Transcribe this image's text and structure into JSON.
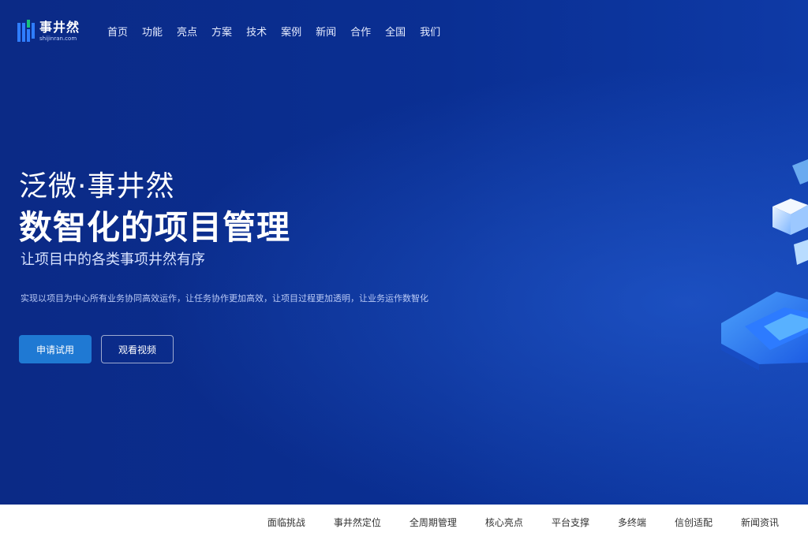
{
  "brand": {
    "name": "事井然",
    "domain": "shijinran.com",
    "colors": {
      "primary": "#1f79d3",
      "hero_bg": "#0a2a86",
      "green": "#19c27a"
    }
  },
  "nav": {
    "items": [
      "首页",
      "功能",
      "亮点",
      "方案",
      "技术",
      "案例",
      "新闻",
      "合作",
      "全国",
      "我们"
    ]
  },
  "hero": {
    "line1": "泛微·事井然",
    "line2": "数智化的项目管理",
    "line3": "让项目中的各类事项井然有序",
    "description": "实现以项目为中心所有业务协同高效运作，让任务协作更加高效，让项目过程更加透明，让业务运作数智化",
    "primary_button": "申请试用",
    "secondary_button": "观看视频"
  },
  "subnav": {
    "items": [
      "面临挑战",
      "事井然定位",
      "全周期管理",
      "核心亮点",
      "平台支撑",
      "多终端",
      "信创适配",
      "新闻资讯"
    ]
  }
}
